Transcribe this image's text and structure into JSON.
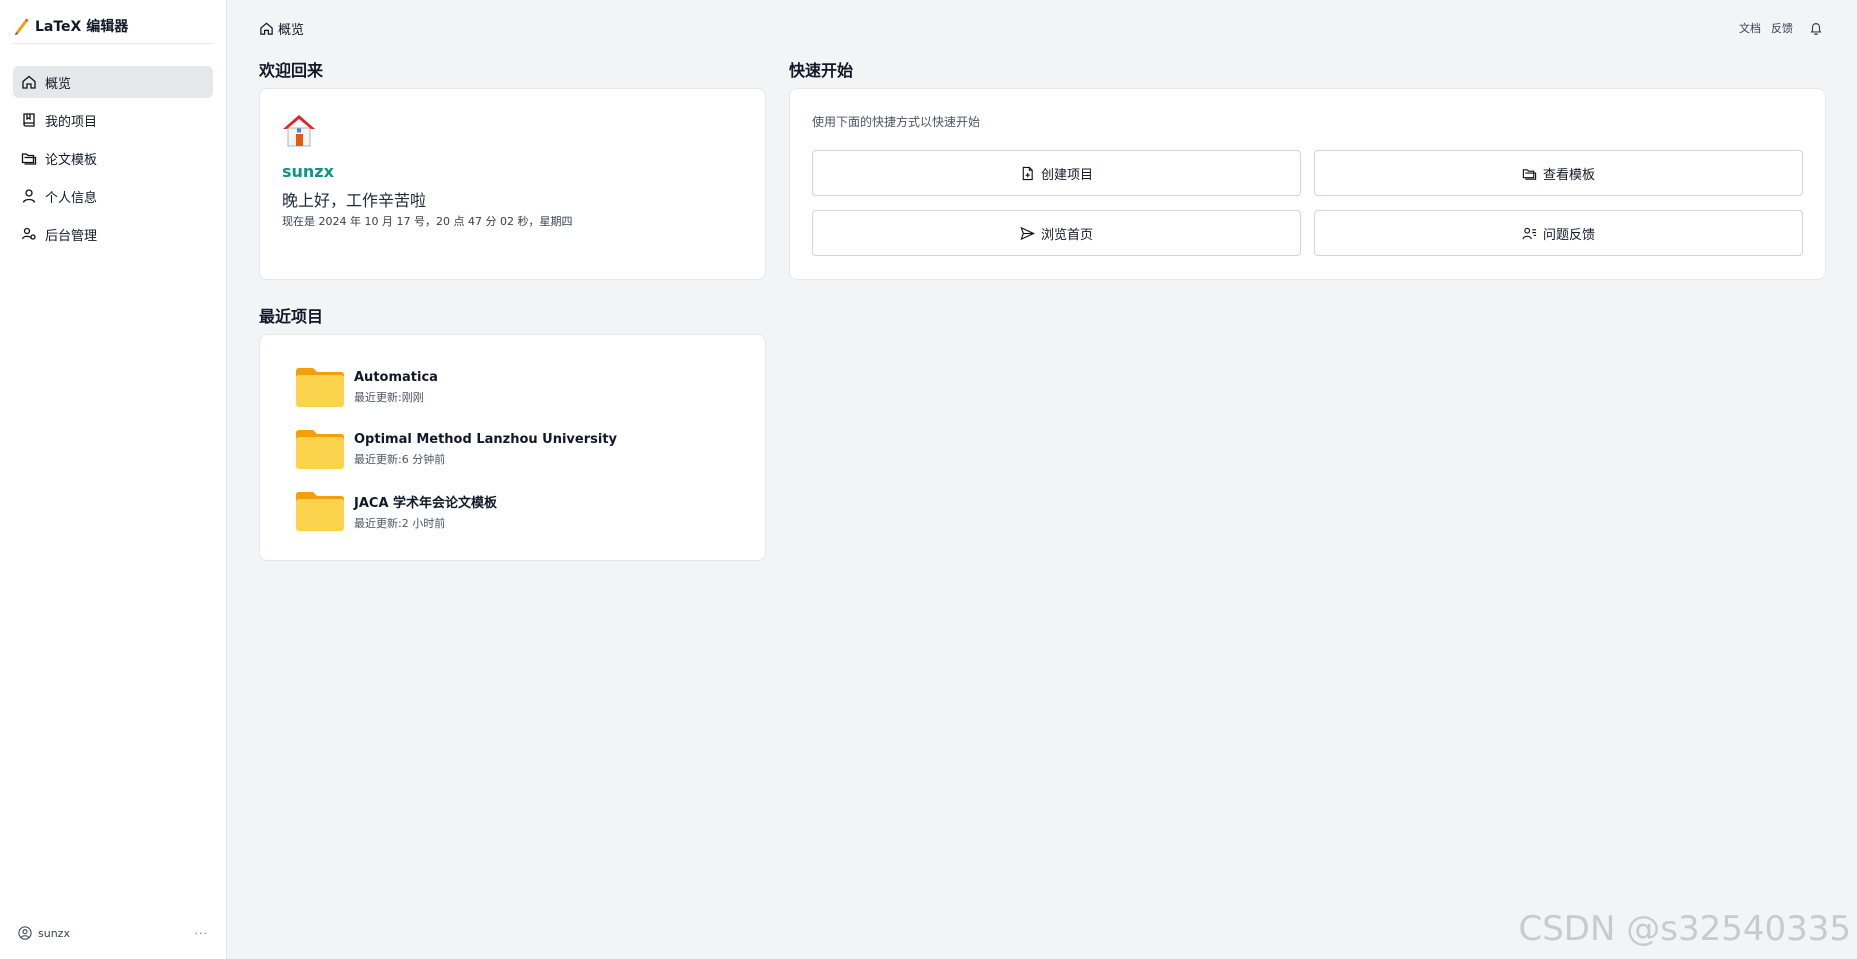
{
  "brand": {
    "title": "LaTeX 编辑器"
  },
  "sidebar": {
    "items": [
      {
        "label": "概览",
        "icon": "home-icon",
        "active": true
      },
      {
        "label": "我的项目",
        "icon": "book-icon"
      },
      {
        "label": "论文模板",
        "icon": "folders-icon"
      },
      {
        "label": "个人信息",
        "icon": "user-icon"
      },
      {
        "label": "后台管理",
        "icon": "users-cog-icon"
      }
    ],
    "user": {
      "name": "sunzx",
      "more": "···"
    }
  },
  "topbar": {
    "breadcrumb": "概览",
    "docs": "文档",
    "feedback": "反馈"
  },
  "welcome": {
    "section_title": "欢迎回来",
    "username": "sunzx",
    "greeting": "晚上好，工作辛苦啦",
    "datetime": "现在是 2024 年 10 月 17 号，20 点 47 分 02 秒，星期四"
  },
  "quick": {
    "section_title": "快速开始",
    "description": "使用下面的快捷方式以快速开始",
    "buttons": [
      {
        "label": "创建项目",
        "icon": "file-plus-icon"
      },
      {
        "label": "查看模板",
        "icon": "folders-icon"
      },
      {
        "label": "浏览首页",
        "icon": "send-icon"
      },
      {
        "label": "问题反馈",
        "icon": "user-list-icon"
      }
    ]
  },
  "recent": {
    "section_title": "最近项目",
    "items": [
      {
        "name": "Automatica",
        "updated": "最近更新:刚刚"
      },
      {
        "name": "Optimal Method Lanzhou University",
        "updated": "最近更新:6 分钟前"
      },
      {
        "name": "JACA 学术年会论文模板",
        "updated": "最近更新:2 小时前"
      }
    ]
  },
  "watermark": "CSDN @s32540335",
  "colors": {
    "accent": "#0f9488",
    "folder": "#fbbf24",
    "active_bg": "#e5e7eb"
  }
}
